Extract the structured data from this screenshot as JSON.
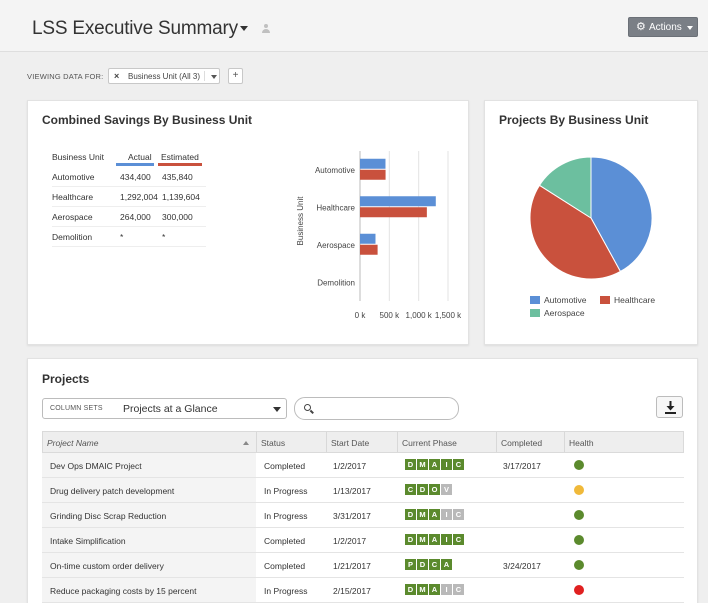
{
  "header": {
    "title": "LSS Executive Summary",
    "actions_label": "Actions"
  },
  "filters": {
    "viewing_label": "VIEWING DATA FOR:",
    "chip_label": "Business Unit (All 3)",
    "add_label": "+"
  },
  "savings": {
    "title": "Combined Savings By Business Unit",
    "col_unit": "Business Unit",
    "col_actual": "Actual",
    "col_estimated": "Estimated",
    "rows": [
      {
        "unit": "Automotive",
        "actual": "434,400",
        "estimated": "435,840"
      },
      {
        "unit": "Healthcare",
        "actual": "1,292,004",
        "estimated": "1,139,604"
      },
      {
        "unit": "Aerospace",
        "actual": "264,000",
        "estimated": "300,000"
      },
      {
        "unit": "Demolition",
        "actual": "*",
        "estimated": "*"
      }
    ]
  },
  "chart_data": [
    {
      "type": "bar",
      "orientation": "horizontal",
      "ylabel": "Business Unit",
      "categories": [
        "Automotive",
        "Healthcare",
        "Aerospace",
        "Demolition"
      ],
      "series": [
        {
          "name": "Actual",
          "color": "#5b8fd6",
          "values": [
            434400,
            1292004,
            264000,
            0
          ]
        },
        {
          "name": "Estimated",
          "color": "#c9513d",
          "values": [
            435840,
            1139604,
            300000,
            0
          ]
        }
      ],
      "xticks": [
        "0 k",
        "500 k",
        "1,000 k",
        "1,500 k"
      ],
      "xlim": [
        0,
        1500000
      ],
      "grid": true
    },
    {
      "type": "pie",
      "title": "Projects By Business Unit",
      "slices": [
        {
          "name": "Automotive",
          "value": 42,
          "color": "#5b8fd6"
        },
        {
          "name": "Healthcare",
          "value": 42,
          "color": "#c9513d"
        },
        {
          "name": "Aerospace",
          "value": 16,
          "color": "#6cbf9f"
        }
      ],
      "legend": "bottom"
    }
  ],
  "projects": {
    "title": "Projects",
    "column_sets_label": "COLUMN SETS",
    "column_sets_value": "Projects at a Glance",
    "search_placeholder": "",
    "headers": {
      "name": "Project Name",
      "status": "Status",
      "start": "Start Date",
      "phase": "Current Phase",
      "completed": "Completed",
      "health": "Health"
    },
    "rows": [
      {
        "name": "Dev Ops DMAIC Project",
        "status": "Completed",
        "start": "1/2/2017",
        "completed": "3/17/2017",
        "health": "#5b8a2d",
        "phase": [
          {
            "l": "D",
            "c": "#5b8a2d"
          },
          {
            "l": "M",
            "c": "#5b8a2d"
          },
          {
            "l": "A",
            "c": "#5b8a2d"
          },
          {
            "l": "I",
            "c": "#5b8a2d"
          },
          {
            "l": "C",
            "c": "#5b8a2d"
          }
        ]
      },
      {
        "name": "Drug delivery patch development",
        "status": "In Progress",
        "start": "1/13/2017",
        "completed": "",
        "health": "#f0b93a",
        "phase": [
          {
            "l": "C",
            "c": "#5b8a2d"
          },
          {
            "l": "D",
            "c": "#5b8a2d"
          },
          {
            "l": "O",
            "c": "#5b8a2d"
          },
          {
            "l": "V",
            "c": "#b9b9b9"
          }
        ]
      },
      {
        "name": "Grinding Disc Scrap Reduction",
        "status": "In Progress",
        "start": "3/31/2017",
        "completed": "",
        "health": "#5b8a2d",
        "phase": [
          {
            "l": "D",
            "c": "#5b8a2d"
          },
          {
            "l": "M",
            "c": "#5b8a2d"
          },
          {
            "l": "A",
            "c": "#5b8a2d"
          },
          {
            "l": "I",
            "c": "#b9b9b9"
          },
          {
            "l": "C",
            "c": "#b9b9b9"
          }
        ]
      },
      {
        "name": "Intake Simplification",
        "status": "Completed",
        "start": "1/2/2017",
        "completed": "",
        "health": "#5b8a2d",
        "phase": [
          {
            "l": "D",
            "c": "#5b8a2d"
          },
          {
            "l": "M",
            "c": "#5b8a2d"
          },
          {
            "l": "A",
            "c": "#5b8a2d"
          },
          {
            "l": "I",
            "c": "#5b8a2d"
          },
          {
            "l": "C",
            "c": "#5b8a2d"
          }
        ]
      },
      {
        "name": "On-time custom order delivery",
        "status": "Completed",
        "start": "1/21/2017",
        "completed": "3/24/2017",
        "health": "#5b8a2d",
        "phase": [
          {
            "l": "P",
            "c": "#5b8a2d"
          },
          {
            "l": "D",
            "c": "#5b8a2d"
          },
          {
            "l": "C",
            "c": "#5b8a2d"
          },
          {
            "l": "A",
            "c": "#5b8a2d"
          }
        ]
      },
      {
        "name": "Reduce packaging costs by 15 percent",
        "status": "In Progress",
        "start": "2/15/2017",
        "completed": "",
        "health": "#e02020",
        "phase": [
          {
            "l": "D",
            "c": "#5b8a2d"
          },
          {
            "l": "M",
            "c": "#5b8a2d"
          },
          {
            "l": "A",
            "c": "#5b8a2d"
          },
          {
            "l": "I",
            "c": "#b9b9b9"
          },
          {
            "l": "C",
            "c": "#b9b9b9"
          }
        ]
      }
    ]
  }
}
